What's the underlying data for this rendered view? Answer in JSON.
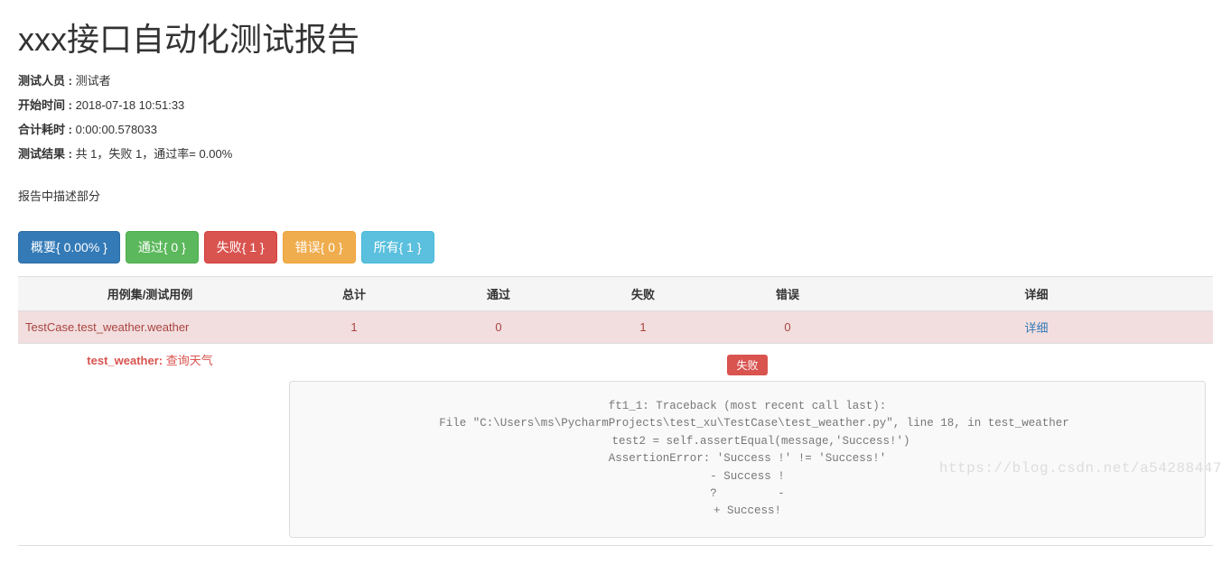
{
  "header": {
    "title": "xxx接口自动化测试报告"
  },
  "meta": {
    "tester_label": "测试人员 : ",
    "tester_value": "测试者",
    "start_label": "开始时间 : ",
    "start_value": "2018-07-18 10:51:33",
    "duration_label": "合计耗时 : ",
    "duration_value": "0:00:00.578033",
    "result_label": "测试结果 : ",
    "result_value": "共 1，失败 1，通过率= 0.00%"
  },
  "description": "报告中描述部分",
  "buttons": {
    "summary": "概要{ 0.00% }",
    "passed": "通过{ 0 }",
    "failed": "失败{ 1 }",
    "error": "错误{ 0 }",
    "all": "所有{ 1 }"
  },
  "table": {
    "headers": {
      "suite": "用例集/测试用例",
      "total": "总计",
      "pass": "通过",
      "fail": "失败",
      "error": "错误",
      "detail": "详细"
    },
    "row": {
      "name": "TestCase.test_weather.weather",
      "total": "1",
      "pass": "0",
      "fail": "1",
      "error": "0",
      "detail_link": "详细"
    }
  },
  "expand": {
    "case_id": "test_weather:",
    "case_desc": " 查询天气",
    "status": "失败",
    "traceback": "ft1_1: Traceback (most recent call last):\n  File \"C:\\Users\\ms\\PycharmProjects\\test_xu\\TestCase\\test_weather.py\", line 18, in test_weather\n    test2 = self.assertEqual(message,'Success!')\nAssertionError: 'Success !' != 'Success!'\n- Success !\n?         -\n+ Success!"
  },
  "watermark": "https://blog.csdn.net/a54288447"
}
